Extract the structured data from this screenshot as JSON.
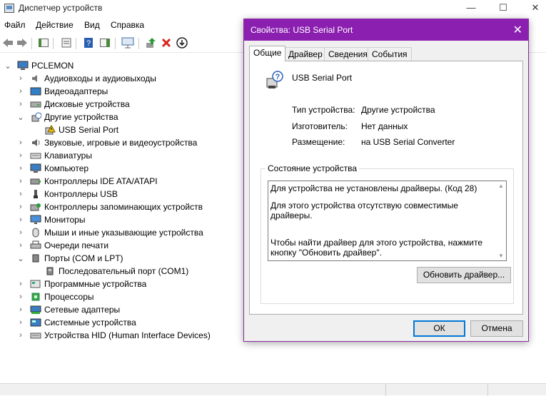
{
  "window": {
    "title": "Диспетчер устройств",
    "minimize": "—",
    "maximize": "☐",
    "close": "✕"
  },
  "menu": [
    "Файл",
    "Действие",
    "Вид",
    "Справка"
  ],
  "toolbar": {
    "icons": [
      "back-arrow-icon",
      "forward-arrow-icon",
      "show-hide-console-tree-icon",
      "properties-icon",
      "help-icon",
      "action-pane-icon",
      "scan-hardware-icon",
      "update-driver-icon",
      "uninstall-device-icon",
      "disable-device-icon"
    ]
  },
  "tree": {
    "root": "PCLEMON",
    "nodes": [
      {
        "label": "Аудиовходы и аудиовыходы",
        "expanded": false,
        "icon": "speaker-icon"
      },
      {
        "label": "Видеоадаптеры",
        "expanded": false,
        "icon": "display-adapter-icon"
      },
      {
        "label": "Дисковые устройства",
        "expanded": false,
        "icon": "disk-drive-icon"
      },
      {
        "label": "Другие устройства",
        "expanded": true,
        "icon": "other-devices-icon"
      },
      {
        "label": "USB Serial Port",
        "child": true,
        "icon": "warning-device-icon"
      },
      {
        "label": "Звуковые, игровые и видеоустройства",
        "expanded": false,
        "icon": "sound-icon"
      },
      {
        "label": "Клавиатуры",
        "expanded": false,
        "icon": "keyboard-icon"
      },
      {
        "label": "Компьютер",
        "expanded": false,
        "icon": "computer-icon"
      },
      {
        "label": "Контроллеры IDE ATA/ATAPI",
        "expanded": false,
        "icon": "ide-controller-icon"
      },
      {
        "label": "Контроллеры USB",
        "expanded": false,
        "icon": "usb-icon"
      },
      {
        "label": "Контроллеры запоминающих устройств",
        "expanded": false,
        "icon": "storage-controller-icon"
      },
      {
        "label": "Мониторы",
        "expanded": false,
        "icon": "monitor-icon"
      },
      {
        "label": "Мыши и иные указывающие устройства",
        "expanded": false,
        "icon": "mouse-icon"
      },
      {
        "label": "Очереди печати",
        "expanded": false,
        "icon": "printer-icon"
      },
      {
        "label": "Порты (COM и LPT)",
        "expanded": true,
        "icon": "port-icon"
      },
      {
        "label": "Последовательный порт (COM1)",
        "child": true,
        "icon": "serial-port-icon"
      },
      {
        "label": "Программные устройства",
        "expanded": false,
        "icon": "software-device-icon"
      },
      {
        "label": "Процессоры",
        "expanded": false,
        "icon": "processor-icon"
      },
      {
        "label": "Сетевые адаптеры",
        "expanded": false,
        "icon": "network-adapter-icon"
      },
      {
        "label": "Системные устройства",
        "expanded": false,
        "icon": "system-device-icon"
      },
      {
        "label": "Устройства HID (Human Interface Devices)",
        "expanded": false,
        "icon": "hid-icon"
      }
    ]
  },
  "dialog": {
    "title": "Свойства: USB Serial Port",
    "close": "✕",
    "tabs": [
      "Общие",
      "Драйвер",
      "Сведения",
      "События"
    ],
    "active_tab": "Общие",
    "device_name": "USB Serial Port",
    "props": [
      {
        "label": "Тип устройства:",
        "value": "Другие устройства"
      },
      {
        "label": "Изготовитель:",
        "value": "Нет данных"
      },
      {
        "label": "Размещение:",
        "value": "на USB Serial Converter"
      }
    ],
    "status_group": "Состояние устройства",
    "status_lines": [
      "Для устройства не установлены драйверы. (Код 28)",
      "Для этого устройства отсутствую совместимые драйверы.",
      "Чтобы найти драйвер для этого устройства, нажмите кнопку \"Обновить драйвер\"."
    ],
    "update_driver_button": "Обновить драйвер...",
    "ok_button": "ОК",
    "cancel_button": "Отмена"
  },
  "colors": {
    "dialog_title_bg": "#8b1fb0",
    "accent_focus": "#0078d7"
  }
}
